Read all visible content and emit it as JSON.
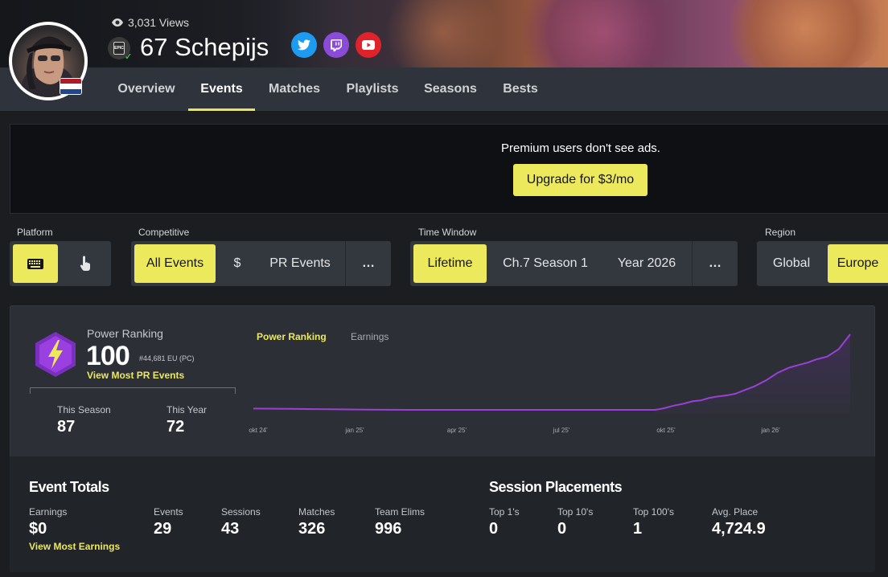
{
  "profile": {
    "views": "3,031 Views",
    "name": "67 Schepijs",
    "platform_badge": "EPIC",
    "flag_colors": [
      "#ae1c28",
      "#ffffff",
      "#21468b"
    ]
  },
  "nav": {
    "tabs": [
      {
        "label": "Overview"
      },
      {
        "label": "Events"
      },
      {
        "label": "Matches"
      },
      {
        "label": "Playlists"
      },
      {
        "label": "Seasons"
      },
      {
        "label": "Bests"
      }
    ],
    "active_tab": "Events"
  },
  "ad": {
    "text": "Premium users don't see ads.",
    "button": "Upgrade for $3/mo"
  },
  "filters": {
    "platform": {
      "label": "Platform",
      "options": [
        "keyboard-icon",
        "touch-icon"
      ],
      "selected": "keyboard-icon"
    },
    "competitive": {
      "label": "Competitive",
      "options": [
        "All Events",
        "$",
        "PR Events",
        "…"
      ],
      "selected": "All Events"
    },
    "time_window": {
      "label": "Time Window",
      "options": [
        "Lifetime",
        "Ch.7 Season 1",
        "Year 2026",
        "…"
      ],
      "selected": "Lifetime"
    },
    "region": {
      "label": "Region",
      "options": [
        "Global",
        "Europe"
      ],
      "selected": "Europe"
    }
  },
  "power_ranking": {
    "title": "Power Ranking",
    "value": "100",
    "rank": "#44,681 EU (PC)",
    "link": "View Most PR Events",
    "this_season_label": "This Season",
    "this_season_value": "87",
    "this_year_label": "This Year",
    "this_year_value": "72"
  },
  "chart_tabs": {
    "active": "Power Ranking",
    "inactive": "Earnings"
  },
  "chart_data": {
    "type": "area",
    "title": "",
    "xlabel": "",
    "ylabel": "",
    "x_tick_labels": [
      "okt 24'",
      "jan 25'",
      "apr 25'",
      "jul 25'",
      "okt 25'",
      "jan 26'"
    ],
    "x": [
      0,
      0.5,
      1,
      1.5,
      2,
      2.5,
      3,
      3.5,
      4,
      4.5,
      4.75,
      4.85,
      5.0,
      5.1,
      5.25,
      5.35,
      5.5,
      5.6,
      5.75,
      5.85,
      5.95,
      6.05,
      6.2,
      6.3,
      6.4,
      6.55,
      6.7,
      6.85,
      7.0,
      7.1,
      7.25,
      7.35,
      7.5,
      7.65,
      7.8
    ],
    "values": [
      0,
      -0.5,
      -1,
      -1.5,
      -2,
      -2.5,
      -3,
      -3.5,
      -4,
      -4.5,
      -4.7,
      -4.8,
      -4.9,
      -5.0,
      -5.0,
      0,
      4,
      6,
      10,
      11,
      14,
      16,
      18,
      20,
      24,
      30,
      38,
      48,
      55,
      58,
      62,
      66,
      70,
      80,
      100
    ],
    "color": "#9c3fd6",
    "fill": "#3e2f52"
  },
  "event_totals": {
    "title": "Event Totals",
    "items": [
      {
        "label": "Earnings",
        "value": "$0"
      },
      {
        "label": "Events",
        "value": "29"
      },
      {
        "label": "Sessions",
        "value": "43"
      },
      {
        "label": "Matches",
        "value": "326"
      },
      {
        "label": "Team Elims",
        "value": "996"
      }
    ],
    "link": "View Most Earnings"
  },
  "session_placements": {
    "title": "Session Placements",
    "items": [
      {
        "label": "Top 1's",
        "value": "0"
      },
      {
        "label": "Top 10's",
        "value": "0"
      },
      {
        "label": "Top 100's",
        "value": "1"
      },
      {
        "label": "Avg. Place",
        "value": "4,724.9"
      }
    ]
  },
  "colors": {
    "accent": "#ece95d",
    "background": "#1b1d21",
    "panel": "#2c3036",
    "line": "#9c3fd6"
  }
}
